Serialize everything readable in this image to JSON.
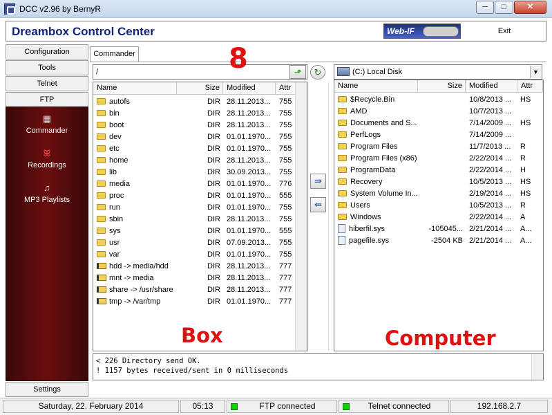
{
  "window": {
    "title": "DCC v2.96 by BernyR",
    "min": "─",
    "max": "□",
    "close": "✕"
  },
  "header": {
    "app_name": "Dreambox Control Center",
    "webif_label": "Web-IF",
    "exit_label": "Exit"
  },
  "nav": {
    "buttons": [
      "Configuration",
      "Tools",
      "Telnet",
      "FTP"
    ],
    "items": [
      {
        "label": "Commander",
        "icon": "grid-icon"
      },
      {
        "label": "Recordings",
        "icon": "film-icon"
      },
      {
        "label": "MP3 Playlists",
        "icon": "music-icon"
      }
    ],
    "settings": "Settings"
  },
  "tab": {
    "label": "Commander"
  },
  "box": {
    "path": "/",
    "columns": [
      "Name",
      "Size",
      "Modified",
      "Attr"
    ],
    "rows": [
      {
        "type": "dir",
        "name": "autofs",
        "size": "DIR",
        "modified": "28.11.2013...",
        "attr": "755"
      },
      {
        "type": "dir",
        "name": "bin",
        "size": "DIR",
        "modified": "28.11.2013...",
        "attr": "755"
      },
      {
        "type": "dir",
        "name": "boot",
        "size": "DIR",
        "modified": "28.11.2013...",
        "attr": "755"
      },
      {
        "type": "dir",
        "name": "dev",
        "size": "DIR",
        "modified": "01.01.1970...",
        "attr": "755"
      },
      {
        "type": "dir",
        "name": "etc",
        "size": "DIR",
        "modified": "01.01.1970...",
        "attr": "755"
      },
      {
        "type": "dir",
        "name": "home",
        "size": "DIR",
        "modified": "28.11.2013...",
        "attr": "755"
      },
      {
        "type": "dir",
        "name": "lib",
        "size": "DIR",
        "modified": "30.09.2013...",
        "attr": "755"
      },
      {
        "type": "dir",
        "name": "media",
        "size": "DIR",
        "modified": "01.01.1970...",
        "attr": "776"
      },
      {
        "type": "dir",
        "name": "proc",
        "size": "DIR",
        "modified": "01.01.1970...",
        "attr": "555"
      },
      {
        "type": "dir",
        "name": "run",
        "size": "DIR",
        "modified": "01.01.1970...",
        "attr": "755"
      },
      {
        "type": "dir",
        "name": "sbin",
        "size": "DIR",
        "modified": "28.11.2013...",
        "attr": "755"
      },
      {
        "type": "dir",
        "name": "sys",
        "size": "DIR",
        "modified": "01.01.1970...",
        "attr": "555"
      },
      {
        "type": "dir",
        "name": "usr",
        "size": "DIR",
        "modified": "07.09.2013...",
        "attr": "755"
      },
      {
        "type": "dir",
        "name": "var",
        "size": "DIR",
        "modified": "01.01.1970...",
        "attr": "755"
      },
      {
        "type": "link",
        "name": "hdd -> media/hdd",
        "size": "DIR",
        "modified": "28.11.2013...",
        "attr": "777"
      },
      {
        "type": "link",
        "name": "mnt -> media",
        "size": "DIR",
        "modified": "28.11.2013...",
        "attr": "777"
      },
      {
        "type": "link",
        "name": "share -> /usr/share",
        "size": "DIR",
        "modified": "28.11.2013...",
        "attr": "777"
      },
      {
        "type": "link",
        "name": "tmp -> /var/tmp",
        "size": "DIR",
        "modified": "01.01.1970...",
        "attr": "777"
      }
    ]
  },
  "computer": {
    "drive": "(C:)  Local Disk",
    "columns": [
      "Name",
      "Size",
      "Modified",
      "Attr"
    ],
    "rows": [
      {
        "type": "dir",
        "name": "$Recycle.Bin",
        "size": "",
        "modified": "10/8/2013 ...",
        "attr": "HS"
      },
      {
        "type": "dir",
        "name": "AMD",
        "size": "",
        "modified": "10/7/2013 ...",
        "attr": ""
      },
      {
        "type": "dir",
        "name": "Documents and S...",
        "size": "",
        "modified": "7/14/2009 ...",
        "attr": "HS"
      },
      {
        "type": "dir",
        "name": "PerfLogs",
        "size": "",
        "modified": "7/14/2009 ...",
        "attr": ""
      },
      {
        "type": "dir",
        "name": "Program Files",
        "size": "",
        "modified": "11/7/2013 ...",
        "attr": "R"
      },
      {
        "type": "dir",
        "name": "Program Files (x86)",
        "size": "",
        "modified": "2/22/2014 ...",
        "attr": "R"
      },
      {
        "type": "dir",
        "name": "ProgramData",
        "size": "",
        "modified": "2/22/2014 ...",
        "attr": "H"
      },
      {
        "type": "dir",
        "name": "Recovery",
        "size": "",
        "modified": "10/5/2013 ...",
        "attr": "HS"
      },
      {
        "type": "dir",
        "name": "System Volume In...",
        "size": "",
        "modified": "2/19/2014 ...",
        "attr": "HS"
      },
      {
        "type": "dir",
        "name": "Users",
        "size": "",
        "modified": "10/5/2013 ...",
        "attr": "R"
      },
      {
        "type": "dir",
        "name": "Windows",
        "size": "",
        "modified": "2/22/2014 ...",
        "attr": "A"
      },
      {
        "type": "file",
        "name": "hiberfil.sys",
        "size": "-105045...",
        "modified": "2/21/2014 ...",
        "attr": "A..."
      },
      {
        "type": "file",
        "name": "pagefile.sys",
        "size": "-2504 KB",
        "modified": "2/21/2014 ...",
        "attr": "A..."
      }
    ]
  },
  "log": [
    "< 226 Directory send OK.",
    "! 1157 bytes received/sent in 0 milliseconds"
  ],
  "overlays": {
    "number": "8",
    "box": "Box",
    "computer": "Computer"
  },
  "status": {
    "date": "Saturday, 22. February 2014",
    "time": "05:13",
    "ftp": "FTP connected",
    "telnet": "Telnet connected",
    "ip": "192.168.2.7"
  }
}
